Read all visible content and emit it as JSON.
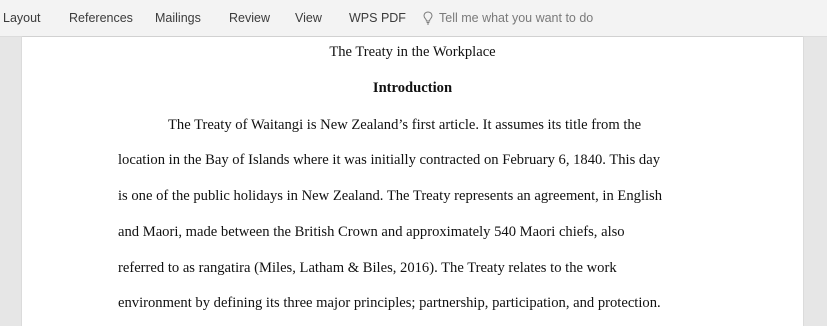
{
  "ribbon": {
    "tabs": [
      "Layout",
      "References",
      "Mailings",
      "Review",
      "View",
      "WPS PDF"
    ],
    "tell_me_placeholder": "Tell me what you want to do",
    "tell_me_icon": "lightbulb-icon"
  },
  "document": {
    "title": "The Treaty in the Workplace",
    "heading": "Introduction",
    "lines": [
      "The Treaty of Waitangi is New Zealand’s first article. It assumes its title from the",
      "location in the Bay of Islands where it was initially contracted on February 6, 1840. This day",
      "is one of the public holidays in New Zealand. The Treaty represents an agreement, in English",
      "and Maori, made between the British Crown and approximately 540 Maori chiefs, also",
      "referred to as rangatira (Miles, Latham & Biles, 2016). The Treaty relates to the work",
      "environment by defining its three major principles; partnership, participation, and protection."
    ]
  }
}
